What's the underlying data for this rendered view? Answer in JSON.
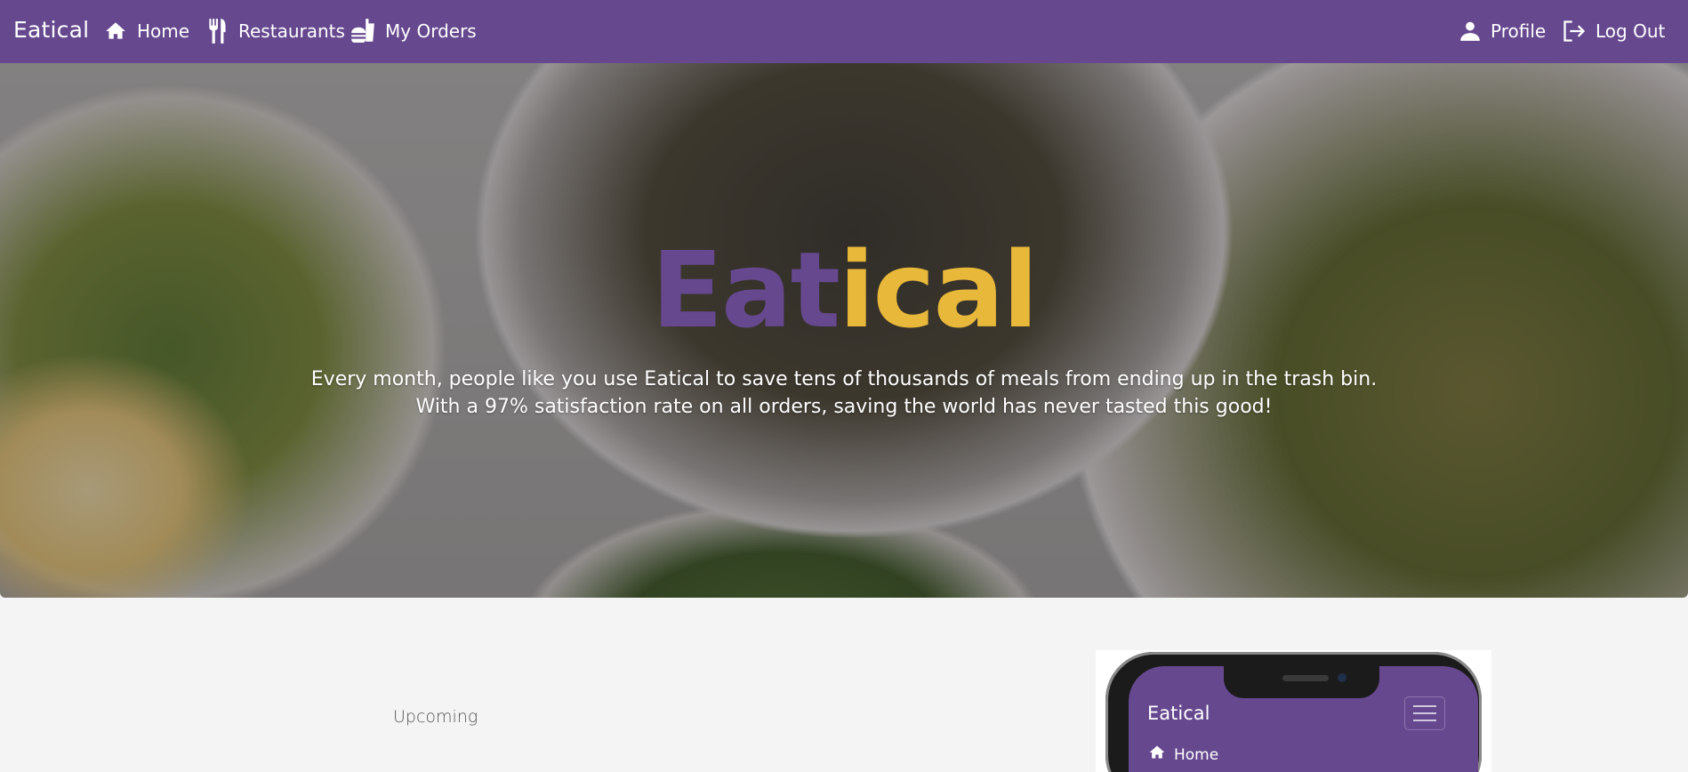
{
  "colors": {
    "brand": "#66488f",
    "accent": "#e8b83a",
    "background": "#f4f4f4"
  },
  "navbar": {
    "brand": "Eatical",
    "links": [
      {
        "label": "Home",
        "icon": "home-icon"
      },
      {
        "label": "Restaurants",
        "icon": "fork-knife-icon"
      },
      {
        "label": "My Orders",
        "icon": "orders-icon"
      }
    ],
    "right": [
      {
        "label": "Profile",
        "icon": "person-icon"
      },
      {
        "label": "Log Out",
        "icon": "logout-icon"
      }
    ]
  },
  "hero": {
    "title_part1": "Eat",
    "title_part2": "ical",
    "line1": "Every month, people like you use Eatical to save tens of thousands of meals from ending up in the trash bin.",
    "line2": "With a 97% satisfaction rate on all orders, saving the world has never tasted this good!"
  },
  "section": {
    "heading": "Upcoming"
  },
  "phone": {
    "brand": "Eatical",
    "menu_item": "Home"
  }
}
